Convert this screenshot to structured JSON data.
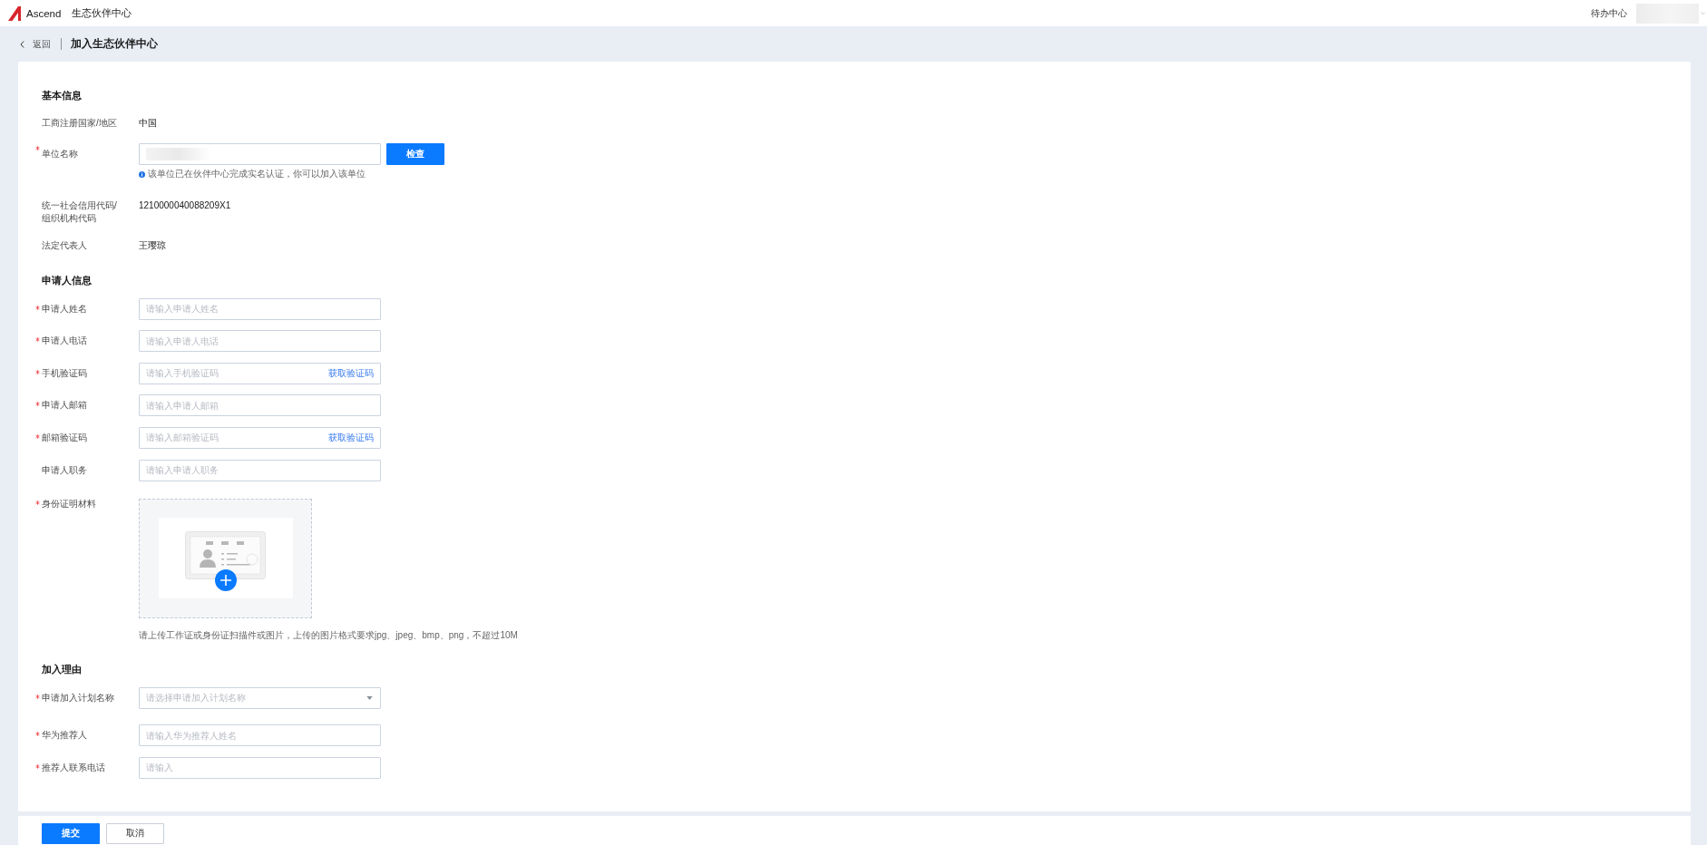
{
  "top_bar": {
    "logo_text": "Ascend",
    "app_name": "生态伙伴中心",
    "todo_link": "待办中心"
  },
  "header": {
    "back_label": "返回",
    "title": "加入生态伙伴中心"
  },
  "sections": [
    {
      "title": "基本信息",
      "fields": [
        {
          "kind": "text",
          "label": "工商注册国家/地区",
          "required": false,
          "value": "中国"
        },
        {
          "kind": "input_button",
          "label": "单位名称",
          "required": true,
          "button": "检查",
          "hint": "该单位已在伙伴中心完成实名认证，你可以加入该单位"
        },
        {
          "kind": "text",
          "label": "统一社会信用代码/组织机构代码",
          "required": false,
          "value": "1210000040088209X1"
        },
        {
          "kind": "text",
          "label": "法定代表人",
          "required": false,
          "value": "王璎琼"
        }
      ]
    },
    {
      "title": "申请人信息",
      "fields": [
        {
          "kind": "input",
          "label": "申请人姓名",
          "required": true,
          "placeholder": "请输入申请人姓名"
        },
        {
          "kind": "input",
          "label": "申请人电话",
          "required": true,
          "placeholder": "请输入申请人电话"
        },
        {
          "kind": "input",
          "label": "手机验证码",
          "required": true,
          "placeholder": "请输入手机验证码",
          "action": "获取验证码"
        },
        {
          "kind": "input",
          "label": "申请人邮箱",
          "required": true,
          "placeholder": "请输入申请人邮箱"
        },
        {
          "kind": "input",
          "label": "邮箱验证码",
          "required": true,
          "placeholder": "请输入邮箱验证码",
          "action": "获取验证码"
        },
        {
          "kind": "input",
          "label": "申请人职务",
          "required": false,
          "placeholder": "请输入申请人职务"
        },
        {
          "kind": "upload",
          "label": "身份证明材料",
          "required": true,
          "hint": "请上传工作证或身份证扫描件或图片，上传的图片格式要求jpg、jpeg、bmp、png，不超过10M"
        }
      ]
    },
    {
      "title": "加入理由",
      "fields": [
        {
          "kind": "select",
          "label": "申请加入计划名称",
          "required": true,
          "placeholder": "请选择申请加入计划名称"
        },
        {
          "kind": "input",
          "label": "华为推荐人",
          "required": true,
          "placeholder": "请输入华为推荐人姓名"
        },
        {
          "kind": "input",
          "label": "推荐人联系电话",
          "required": true,
          "placeholder": "请输入"
        }
      ]
    }
  ],
  "footer": {
    "buttons": [
      {
        "label": "提交",
        "kind": "primary"
      },
      {
        "label": "取消",
        "kind": "secondary"
      }
    ]
  }
}
